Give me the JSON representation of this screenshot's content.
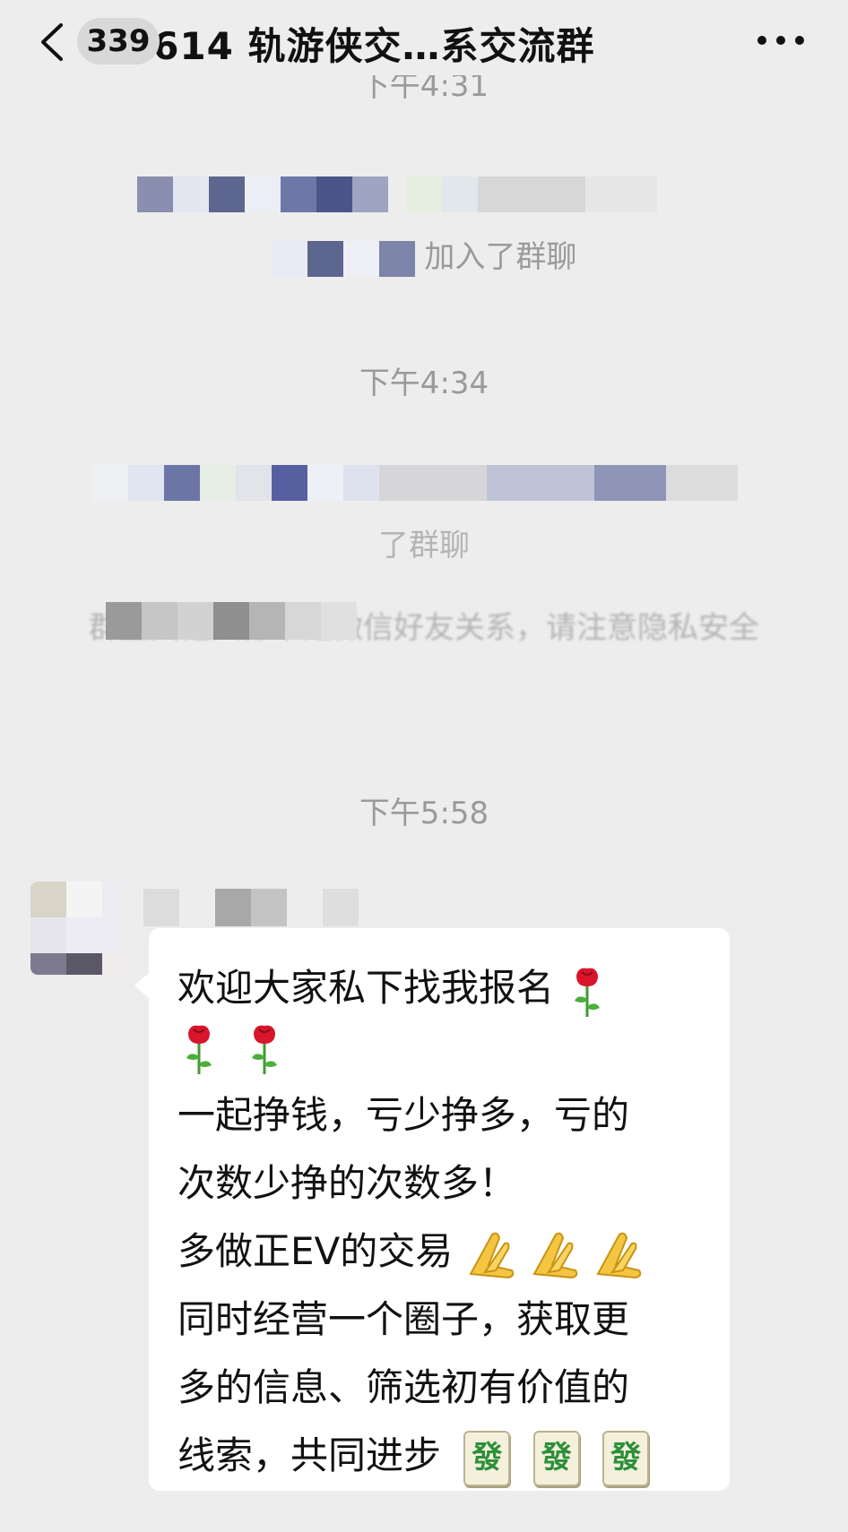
{
  "header": {
    "back_label": "<",
    "unread_count": "339",
    "title": "0614 轨游侠交…系交流群",
    "more_label": "···"
  },
  "timestamps": [
    "下午4:31",
    "下午4:34",
    "下午5:58"
  ],
  "system_messages": [
    {
      "text": "加入了群聊"
    },
    {
      "text": "了群聊"
    },
    {
      "text": "群里其他人都不是微信好友关系，请注意隐私安全"
    }
  ],
  "message": {
    "lines": [
      "欢迎大家私下找我报名",
      "一起挣钱，亏少挣多，亏的",
      "次数少挣的次数多！",
      "多做正EV的交易",
      "同时经营一个圈子，获取更",
      "多的信息、筛选初有价值的",
      "线索，共同进步"
    ],
    "emojis": {
      "rose": "rose-icon",
      "pray": "folded-hands-icon",
      "mahjong": "發"
    }
  },
  "colors": {
    "background": "#ededed",
    "bubble": "#ffffff",
    "timestamp_text": "#9a9a9a",
    "rose": "#d8152a"
  }
}
